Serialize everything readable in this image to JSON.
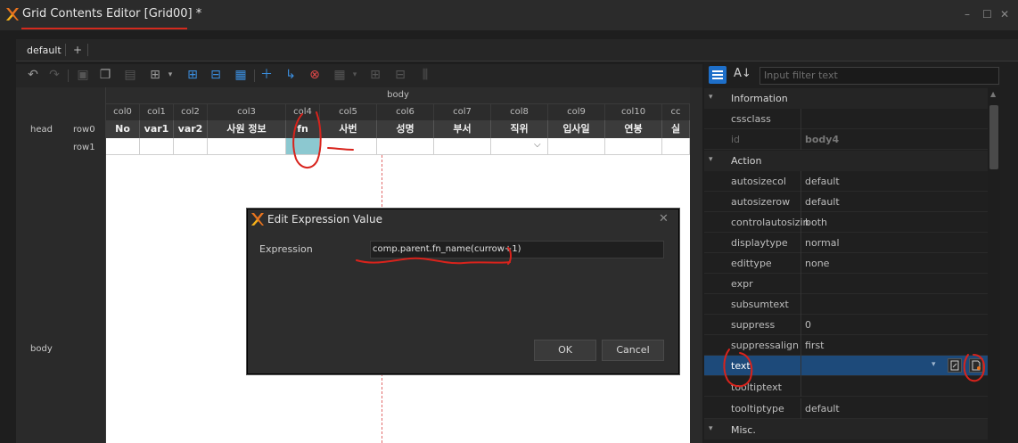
{
  "window": {
    "title": "Grid Contents Editor [Grid00] *",
    "minimize": "–",
    "maximize": "☐",
    "close": "✕"
  },
  "tabs": {
    "active": "default",
    "add": "+"
  },
  "grid": {
    "band_label": "body",
    "columns": [
      "col0",
      "col1",
      "col2",
      "col3",
      "col4",
      "col5",
      "col6",
      "col7",
      "col8",
      "col9",
      "col10",
      "cc"
    ],
    "head_cells": [
      "No",
      "var1",
      "var2",
      "사원 정보",
      "fn",
      "사번",
      "성명",
      "부서",
      "직위",
      "입사일",
      "연봉",
      "실"
    ],
    "rows": [
      {
        "band": "head",
        "name": "row0"
      },
      {
        "band": "",
        "name": "row1"
      }
    ],
    "body_band": "body",
    "dropdown_glyph": "⌵"
  },
  "dialog": {
    "title": "Edit Expression Value",
    "close": "✕",
    "label": "Expression",
    "value": "comp.parent.fn_name(currow+1)",
    "ok": "OK",
    "cancel": "Cancel"
  },
  "properties": {
    "filter_placeholder": "Input filter text",
    "sort_glyph": "A↓",
    "categories": [
      {
        "name": "Information",
        "rows": [
          {
            "name": "cssclass",
            "value": ""
          },
          {
            "name": "id",
            "value": "body4"
          }
        ]
      },
      {
        "name": "Action",
        "rows": [
          {
            "name": "autosizecol",
            "value": "default"
          },
          {
            "name": "autosizerow",
            "value": "default"
          },
          {
            "name": "controlautosizin",
            "value": "both"
          },
          {
            "name": "displaytype",
            "value": "normal"
          },
          {
            "name": "edittype",
            "value": "none"
          },
          {
            "name": "expr",
            "value": ""
          },
          {
            "name": "subsumtext",
            "value": ""
          },
          {
            "name": "suppress",
            "value": "0"
          },
          {
            "name": "suppressalign",
            "value": "first"
          },
          {
            "name": "text",
            "value": ""
          },
          {
            "name": "tooltiptext",
            "value": ""
          },
          {
            "name": "tooltiptype",
            "value": "default"
          }
        ]
      },
      {
        "name": "Misc.",
        "rows": []
      }
    ]
  },
  "colors": {
    "accent": "#1e6fc9",
    "selected_row": "#1d4a7a",
    "annotation": "#d8231c",
    "selected_cell": "#8cc8d0"
  }
}
